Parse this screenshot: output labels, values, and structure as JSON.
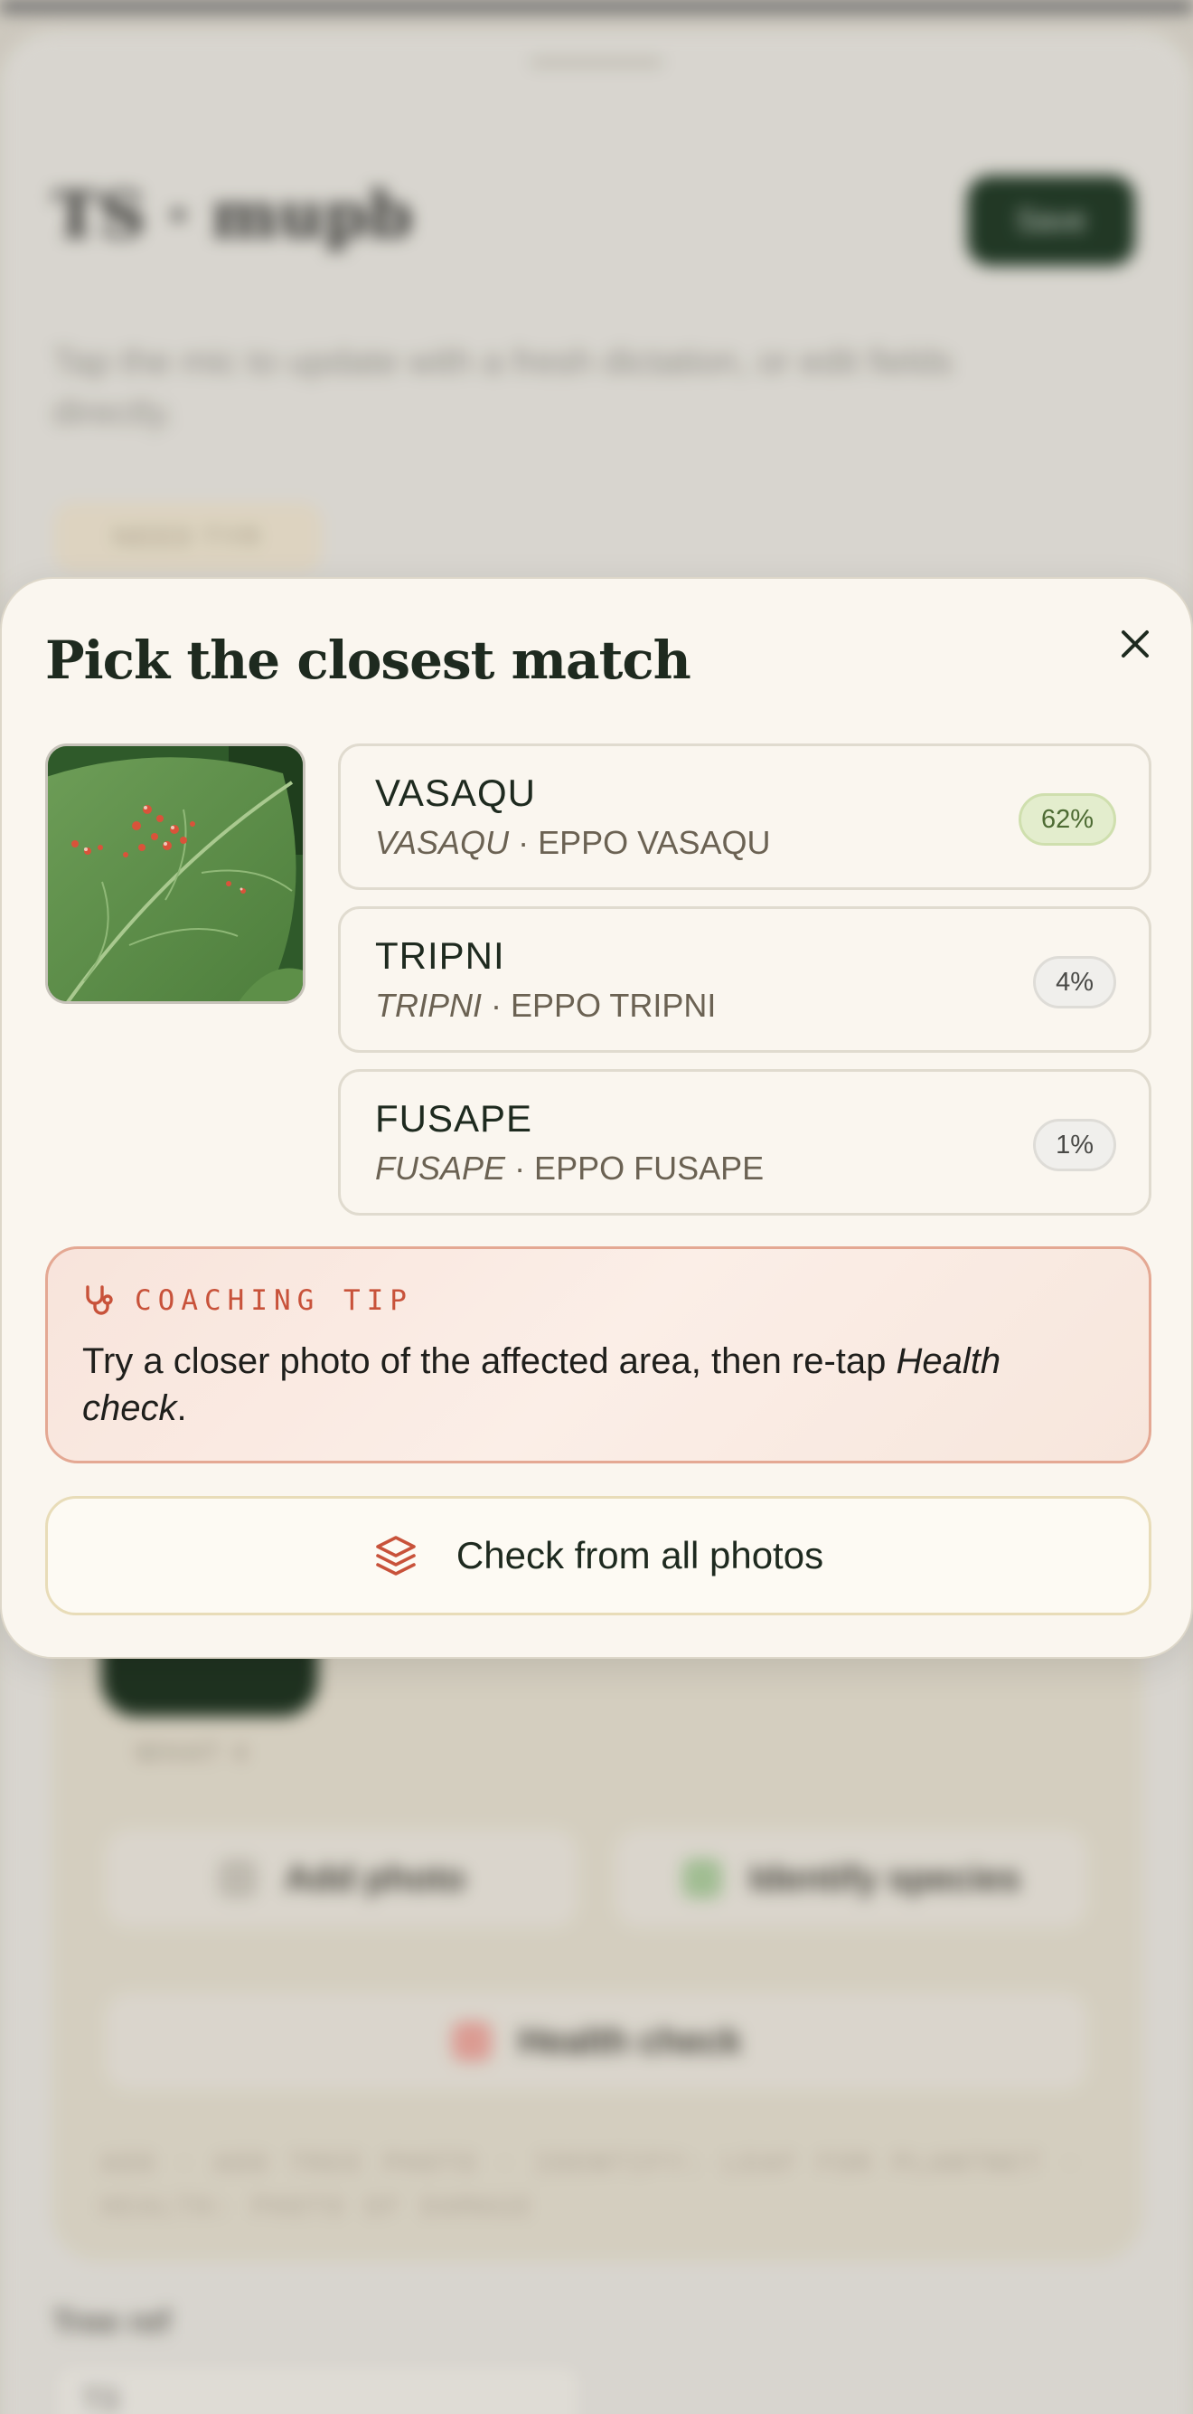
{
  "background": {
    "title": "TS · mupb",
    "save_label": "Save",
    "hint": "Tap the mic to update with a fresh dictation, or edit fields directly.",
    "chip_label": "NEED TYR",
    "photo_caption": "WHAT 4",
    "add_photo_label": "Add photo",
    "identify_label": "Identify species",
    "health_label": "Health check",
    "fine_print": "ADD · ADD TREE PHOTO · IDENTIFY: LEAF FOR PLANTNET · HEALTH: PHOTO OF DAMAGE",
    "field_label": "Tree ref",
    "field_value": "T3"
  },
  "modal": {
    "title": "Pick the closest match",
    "close_icon": "close-icon",
    "thumbnail_alt": "leaf with red galls",
    "matches": [
      {
        "name": "VASAQU",
        "sci": "VASAQU",
        "code": "· EPPO VASAQU",
        "confidence": "62%",
        "confidence_value": 0.62
      },
      {
        "name": "TRIPNI",
        "sci": "TRIPNI",
        "code": "· EPPO TRIPNI",
        "confidence": "4%",
        "confidence_value": 0.04
      },
      {
        "name": "FUSAPE",
        "sci": "FUSAPE",
        "code": "· EPPO FUSAPE",
        "confidence": "1%",
        "confidence_value": 0.01
      }
    ],
    "tip": {
      "icon": "stethoscope-icon",
      "label": "COACHING TIP",
      "body_prefix": "Try a closer photo of the affected area, then re-tap ",
      "body_emphasis": "Health check",
      "body_suffix": "."
    },
    "check_all": {
      "icon": "layers-icon",
      "label": "Check from all photos"
    }
  },
  "colors": {
    "accent": "#c8523a",
    "brand_dark": "#1e2a1f",
    "sheet_bg": "#faf6ef",
    "high_confidence": "#e3edcd"
  }
}
